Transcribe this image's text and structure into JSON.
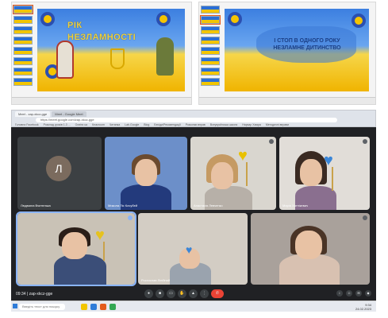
{
  "slides": {
    "left_title_line1": "РІК",
    "left_title_line2": "НЕЗЛАМНОСТІ",
    "right_title": "І СТОП В ОДНОГО РОКУ НЕЗЛАМНЕ ДИТИНСТВО"
  },
  "browser": {
    "tabs": [
      "Meet - zap-xkcz-gge",
      "Meet - Google Meet"
    ],
    "url": "https://meet.google.com/zap-xkcz-gge",
    "bookmarks": [
      "Головна Facebook",
      "Розклад уроків 1-3 ...",
      "Освіта ua",
      "Класroom",
      "Читанка",
      "Lab.Google",
      "Blog",
      "Бесіди/Рекомендації",
      "Розкопки вправ",
      "Всеукраїнська школа",
      "Hapsap Хмара",
      "Методичні вправи"
    ]
  },
  "meet": {
    "participants": [
      {
        "name": "Людмила Вчителька",
        "initial": "Л"
      },
      {
        "name": "Микола Ліс Кочубей"
      },
      {
        "name": "Анастасія Левченко"
      },
      {
        "name": "Марія Хатнікевич"
      },
      {
        "name": ""
      },
      {
        "name": "Ростислав Лінійний"
      },
      {
        "name": ""
      }
    ],
    "time_label": "09:34 | zap-xkcz-gge"
  },
  "taskbar": {
    "search_placeholder": "Введіть текст для пошуку",
    "time": "9:34",
    "date": "24.02.2023"
  },
  "colors": {
    "meet_bg": "#202124",
    "end_call": "#ea4335",
    "ukraine_blue": "#2a6fd6",
    "ukraine_yellow": "#f2c500"
  }
}
